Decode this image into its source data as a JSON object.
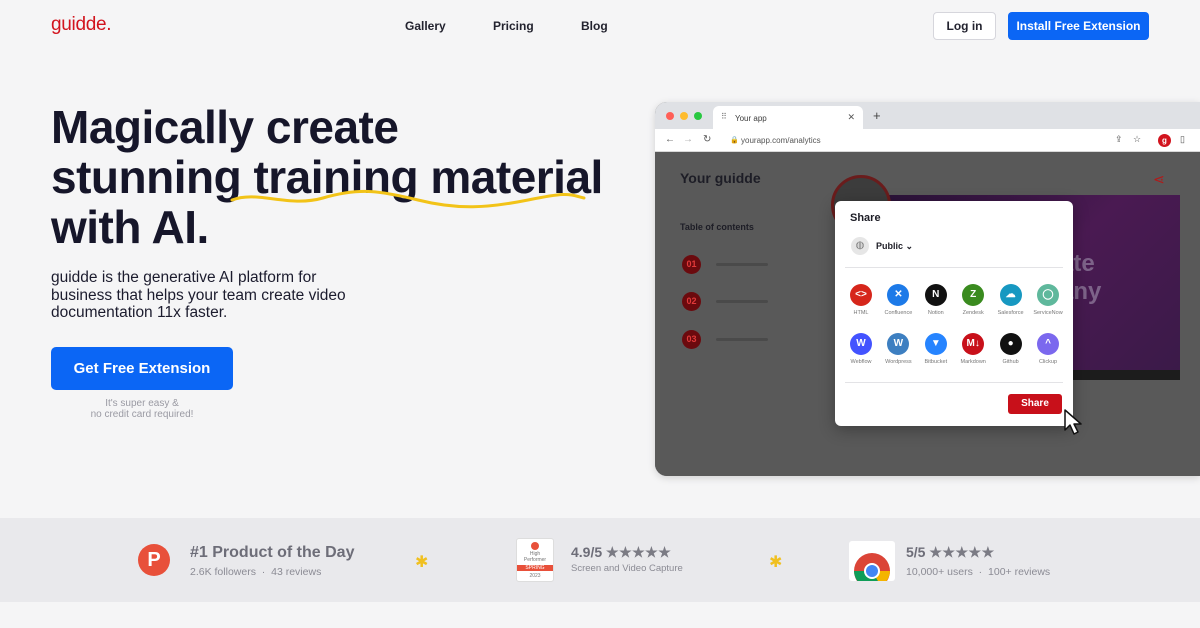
{
  "nav": {
    "logo": "guidde.",
    "links": [
      "Gallery",
      "Pricing",
      "Blog"
    ],
    "login": "Log in",
    "install": "Install Free Extension"
  },
  "hero": {
    "title_lines": [
      "Magically create",
      "stunning training material",
      "with AI."
    ],
    "subtitle": "guidde is the generative AI platform for business that helps your team create video documentation 11x faster.",
    "cta": "Get Free Extension",
    "note_lines": [
      "It's super easy &",
      "no credit card required!"
    ]
  },
  "browser": {
    "tab_title": "Your app",
    "url": "yourapp.com/analytics",
    "extension_icon": "g",
    "guidde_title": "Your guidde",
    "toc_label": "Table of contents",
    "toc_numbers": [
      "01",
      "02",
      "03"
    ],
    "video_text_lines": [
      "ate",
      "any"
    ]
  },
  "share_dialog": {
    "title": "Share",
    "visibility": "Public",
    "services": [
      {
        "label": "HTML",
        "icon": "html-icon",
        "color": "#d6261b",
        "glyph": "<>"
      },
      {
        "label": "Confluence",
        "icon": "confluence-icon",
        "color": "#1d7ae8",
        "glyph": "✕"
      },
      {
        "label": "Notion",
        "icon": "notion-icon",
        "color": "#111111",
        "glyph": "N"
      },
      {
        "label": "Zendesk",
        "icon": "zendesk-icon",
        "color": "#3a8b1f",
        "glyph": "Z"
      },
      {
        "label": "Salesforce",
        "icon": "salesforce-icon",
        "color": "#1798c1",
        "glyph": "☁"
      },
      {
        "label": "ServiceNow",
        "icon": "servicenow-icon",
        "color": "#5fb89c",
        "glyph": "◯"
      },
      {
        "label": "Webflow",
        "icon": "webflow-icon",
        "color": "#4353ff",
        "glyph": "W"
      },
      {
        "label": "Wordpress",
        "icon": "wordpress-icon",
        "color": "#3d7fc1",
        "glyph": "W"
      },
      {
        "label": "Bitbucket",
        "icon": "bitbucket-icon",
        "color": "#2684ff",
        "glyph": "▼"
      },
      {
        "label": "Markdown",
        "icon": "markdown-icon",
        "color": "#c8101a",
        "glyph": "M↓"
      },
      {
        "label": "Github",
        "icon": "github-icon",
        "color": "#111111",
        "glyph": "●"
      },
      {
        "label": "Clickup",
        "icon": "clickup-icon",
        "color": "#7b68ee",
        "glyph": "^"
      }
    ],
    "share_button": "Share"
  },
  "badges": {
    "producthunt": {
      "title": "#1 Product of the Day",
      "followers": "2.6K followers",
      "reviews": "43 reviews"
    },
    "g2": {
      "rating": "4.9/5",
      "stars": "★★★★★",
      "category": "Screen and Video Capture",
      "badge_lines": [
        "High",
        "Performer",
        "SPRING",
        "2023"
      ]
    },
    "chrome": {
      "rating": "5/5",
      "stars": "★★★★★",
      "users": "10,000+ users",
      "reviews": "100+ reviews"
    }
  },
  "colors": {
    "brand": "#d2141e",
    "primary": "#0b66f5"
  }
}
